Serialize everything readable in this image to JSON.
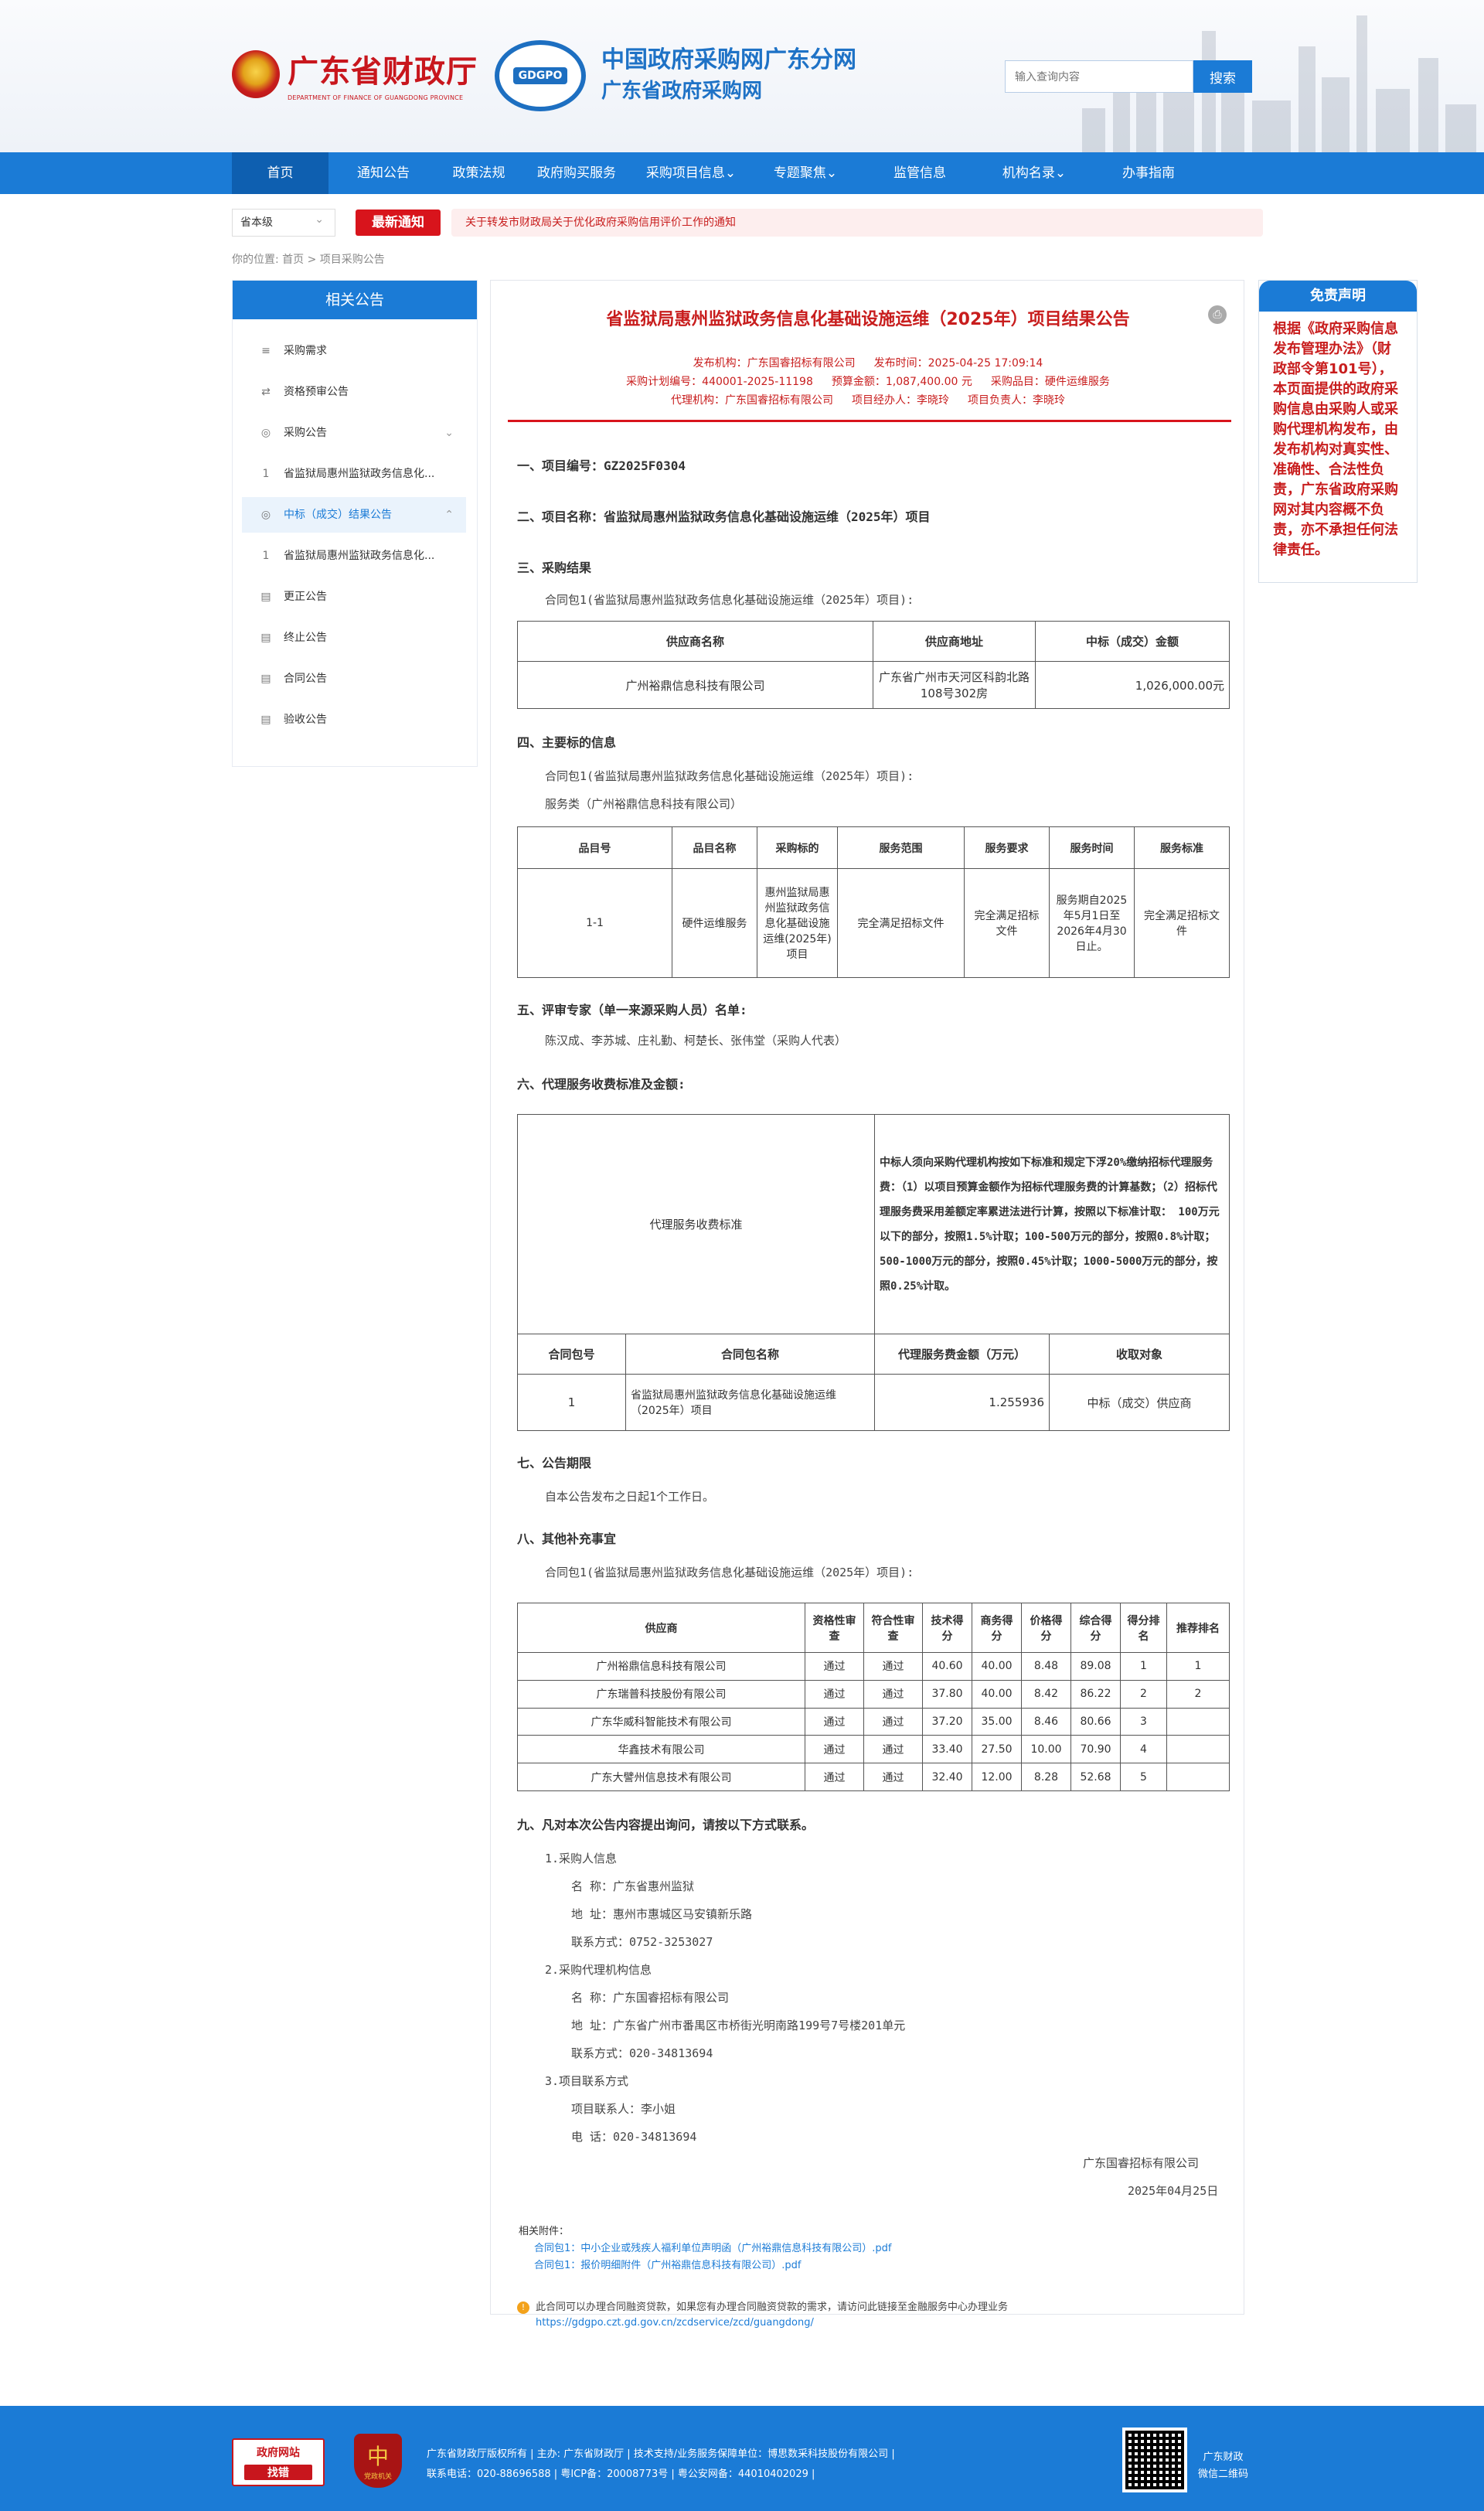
{
  "header": {
    "org_cn": "广东省财政厅",
    "org_en": "DEPARTMENT OF FINANCE OF GUANGDONG PROVINCE",
    "gdgpo_label": "GDGPO",
    "site_title_1": "中国政府采购网广东分网",
    "site_title_2": "广东省政府采购网",
    "search_placeholder": "输入查询内容",
    "search_button": "搜索"
  },
  "nav": [
    "首页",
    "通知公告",
    "政策法规",
    "政府购买服务",
    "采购项目信息⌄",
    "专题聚焦⌄",
    "监管信息",
    "机构名录⌄",
    "办事指南"
  ],
  "notice": {
    "level": "省本级",
    "badge": "最新通知",
    "text": "关于转发市财政局关于优化政府采购信用评价工作的通知"
  },
  "breadcrumb": "你的位置:  首页 > 项目采购公告",
  "sidebar": {
    "title": "相关公告",
    "items": [
      {
        "icon": "≡",
        "label": "采购需求"
      },
      {
        "icon": "⇄",
        "label": "资格预审公告"
      },
      {
        "icon": "◎",
        "label": "采购公告",
        "chev": "⌄"
      },
      {
        "icon": "1",
        "label": "省监狱局惠州监狱政务信息化..."
      },
      {
        "icon": "◎",
        "label": "中标（成交）结果公告",
        "chev": "⌃"
      },
      {
        "icon": "1",
        "label": "省监狱局惠州监狱政务信息化..."
      },
      {
        "icon": "▤",
        "label": "更正公告"
      },
      {
        "icon": "▤",
        "label": "终止公告"
      },
      {
        "icon": "▤",
        "label": "合同公告"
      },
      {
        "icon": "▤",
        "label": "验收公告"
      }
    ]
  },
  "article": {
    "title": "省监狱局惠州监狱政务信息化基础设施运维（2025年）项目结果公告",
    "meta1": [
      "发布机构：广东国睿招标有限公司",
      "发布时间：2025-04-25 17:09:14"
    ],
    "meta2": [
      "采购计划编号：440001-2025-11198",
      "预算金额：1,087,400.00 元",
      "采购品目：硬件运维服务"
    ],
    "meta3": [
      "代理机构：广东国睿招标有限公司",
      "项目经办人：李晓玲",
      "项目负责人：李晓玲"
    ],
    "s1": "一、项目编号：GZ2025F0304",
    "s2": "二、项目名称：省监狱局惠州监狱政务信息化基础设施运维（2025年）项目",
    "s3": "三、采购结果",
    "s3_pkg": "合同包1(省监狱局惠州监狱政务信息化基础设施运维（2025年）项目):",
    "t1_head": [
      "供应商名称",
      "供应商地址",
      "中标（成交）金额"
    ],
    "t1_row": [
      "广州裕鼎信息科技有限公司",
      "广东省广州市天河区科韵北路108号302房",
      "1,026,000.00元"
    ],
    "s4": "四、主要标的信息",
    "s4_pkg": "合同包1(省监狱局惠州监狱政务信息化基础设施运维（2025年）项目):",
    "s4_type": "服务类（广州裕鼎信息科技有限公司）",
    "t2_head": [
      "品目号",
      "品目名称",
      "采购标的",
      "服务范围",
      "服务要求",
      "服务时间",
      "服务标准"
    ],
    "t2_row": [
      "1-1",
      "硬件运维服务",
      "惠州监狱局惠州监狱政务信息化基础设施运维(2025年)项目",
      "完全满足招标文件",
      "完全满足招标文件",
      "服务期自2025年5月1日至 2026年4月30日止。",
      "完全满足招标文件"
    ],
    "s5": "五、评审专家（单一来源采购人员）名单:",
    "s5_names": "陈汉成、李苏城、庄礼勤、柯楚长、张伟堂（采购人代表）",
    "s6": "六、代理服务收费标准及金额:",
    "t3_label": "代理服务收费标准",
    "t3_text": "中标人须向采购代理机构按如下标准和规定下浮20%缴纳招标代理服务费：（1）以项目预算金额作为招标代理服务费的计算基数；（2）招标代理服务费采用差额定率累进法进行计算，按照以下标准计取：  100万元以下的部分，按照1.5%计取；100-500万元的部分，按照0.8%计取；500-1000万元的部分，按照0.45%计取；1000-5000万元的部分，按照0.25%计取。",
    "t3_head": [
      "合同包号",
      "合同包名称",
      "代理服务费金额（万元）",
      "收取对象"
    ],
    "t3_row": [
      "1",
      "省监狱局惠州监狱政务信息化基础设施运维（2025年）项目",
      "1.255936",
      "中标（成交）供应商"
    ],
    "s7": "七、公告期限",
    "s7_text": "自本公告发布之日起1个工作日。",
    "s8": "八、其他补充事宜",
    "s8_pkg": "合同包1(省监狱局惠州监狱政务信息化基础设施运维（2025年）项目):",
    "t4_head": [
      "供应商",
      "资格性审查",
      "符合性审查",
      "技术得分",
      "商务得分",
      "价格得分",
      "综合得分",
      "得分排名",
      "推荐排名"
    ],
    "t4_rows": [
      [
        "广州裕鼎信息科技有限公司",
        "通过",
        "通过",
        "40.60",
        "40.00",
        "8.48",
        "89.08",
        "1",
        "1"
      ],
      [
        "广东瑞普科技股份有限公司",
        "通过",
        "通过",
        "37.80",
        "40.00",
        "8.42",
        "86.22",
        "2",
        "2"
      ],
      [
        "广东华威科智能技术有限公司",
        "通过",
        "通过",
        "37.20",
        "35.00",
        "8.46",
        "80.66",
        "3",
        ""
      ],
      [
        "华鑫技术有限公司",
        "通过",
        "通过",
        "33.40",
        "27.50",
        "10.00",
        "70.90",
        "4",
        ""
      ],
      [
        "广东大譬州信息技术有限公司",
        "通过",
        "通过",
        "32.40",
        "12.00",
        "8.28",
        "52.68",
        "5",
        ""
      ]
    ],
    "s9": "九、凡对本次公告内容提出询问，请按以下方式联系。",
    "contact": [
      "1.采购人信息",
      "名    称：广东省惠州监狱",
      "地    址：惠州市惠城区马安镇新乐路",
      "联系方式：0752-3253027",
      "2.采购代理机构信息",
      "名    称：广东国睿招标有限公司",
      "地    址：广东省广州市番禺区市桥街光明南路199号7号楼201单元",
      "联系方式：020-34813694",
      "3.项目联系方式",
      "项目联系人：李小姐",
      "电    话：020-34813694"
    ],
    "sign_org": "广东国睿招标有限公司",
    "sign_date": "2025年04月25日",
    "attach_label": "相关附件：",
    "attach": [
      "合同包1：中小企业或残疾人福利单位声明函（广州裕鼎信息科技有限公司）.pdf",
      "合同包1：报价明细附件（广州裕鼎信息科技有限公司）.pdf"
    ],
    "tip": "此合同可以办理合同融资贷款，如果您有办理合同融资贷款的需求，请访问此链接至金融服务中心办理业务",
    "tip_link": "https://gdgpo.czt.gd.gov.cn/zcdservice/zcd/guangdong/"
  },
  "disclaimer": {
    "title": "免责声明",
    "text": "根据《政府采购信息发布管理办法》（财政部令第101号），本页面提供的政府采购信息由采购人或采购代理机构发布，由发布机构对真实性、准确性、合法性负责，广东省政府采购网对其内容概不负责，亦不承担任何法律责任。"
  },
  "footer": {
    "badge1_a": "政府网站",
    "badge1_b": "找错",
    "badge2": "党政机关",
    "line1": "广东省财政厅版权所有 | 主办: 广东省财政厅 | 技术支持/业务服务保障单位：博思数采科技股份有限公司 |",
    "line2": "联系电话：020-88696588 | 粤ICP备：20008773号 | 粤公安网备：44010402029 |",
    "qr_label1": "广东财政",
    "qr_label2": "微信二维码"
  },
  "colors": {
    "brand_blue": "#1b7bd6",
    "accent_red": "#c81d1d"
  }
}
